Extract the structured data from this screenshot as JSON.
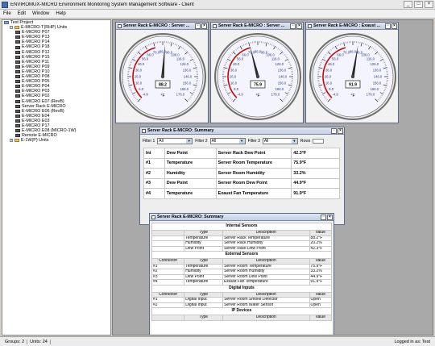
{
  "window": {
    "title": "ENVIROMUX-MICRO Environment Monitoring System Management Software - Client",
    "minimize": "_",
    "maximize": "□",
    "close": "×"
  },
  "menu": [
    "File",
    "Edit",
    "Window",
    "Help"
  ],
  "tree": {
    "root": "Test Project",
    "groups": [
      {
        "label": "E-MICRO-T(RHP) Units",
        "items": [
          "E-MICRO P07",
          "E-MICRO P13",
          "E-MICRO P14",
          "E-MICRO P18",
          "E-MICRO P12",
          "E-MICRO P15",
          "E-MICRO P11",
          "E-MICRO P09",
          "E-MICRO P10",
          "E-MICRO P08",
          "E-MICRO P05",
          "E-MICRO P04",
          "E-MICRO P03",
          "E-MICRO P02",
          "E-MICRO E07 (RevB)",
          "Server Rack E-MICRO",
          "E-MICRO E06 (RevB)",
          "E-MICRO E04",
          "E-MICRO E03",
          "E-MICRO P17",
          "E-MICRO E08 (MICRO-1W)",
          "Remote E-MICRO"
        ]
      },
      {
        "label": "E-1W(P) Units",
        "items": []
      }
    ]
  },
  "gauges": [
    {
      "title": "Server Rack E-MICRO : Server ...",
      "value": 88.2,
      "display": "88.2",
      "unit": "°F",
      "ticks": [
        "-4.9",
        "6.0",
        "16.0",
        "26.0",
        "36.0",
        "46.0",
        "56.0",
        "66.0",
        "76.0",
        "86.0",
        "96.0",
        "106.0",
        "116.0",
        "126.0",
        "136.0",
        "146.0",
        "156.0",
        "166.0",
        "176.0"
      ]
    },
    {
      "title": "Server Rack E-MICRO : Server ...",
      "value": 75.9,
      "display": "75.9",
      "unit": "°F",
      "ticks": [
        "-4.9",
        "6.0",
        "16.0",
        "26.0",
        "36.0",
        "46.0",
        "56.0",
        "66.0",
        "76.0",
        "86.0",
        "96.0",
        "106.0",
        "116.0",
        "126.0",
        "136.0",
        "146.0",
        "156.0",
        "166.0",
        "176.0"
      ]
    },
    {
      "title": "Server Rack E-MICRO : Exaust ...",
      "value": 91.9,
      "display": "91.9",
      "unit": "°F",
      "ticks": [
        "-4.9",
        "6.0",
        "16.0",
        "26.0",
        "36.0",
        "46.0",
        "56.0",
        "66.0",
        "76.0",
        "86.0",
        "96.0",
        "106.0",
        "116.0",
        "126.0",
        "136.0",
        "146.0",
        "156.0",
        "166.0",
        "176.0"
      ]
    }
  ],
  "summary": {
    "title": "Server Rack E-MICRO: Summary",
    "filter1_label": "Filter 1",
    "filter1_value": "All",
    "filter2_label": "Filter 2",
    "filter2_value": "All",
    "filter3_label": "Filter 3",
    "filter3_value": "All",
    "rows_label": "Rows",
    "rows": [
      [
        "Int",
        "Dew Point",
        "Server Rack Dew Point",
        "42.3°F"
      ],
      [
        "#1",
        "Temperature",
        "Server Room Temperature",
        "75.9°F"
      ],
      [
        "#2",
        "Humidity",
        "Server Room Humidity",
        "33.2%"
      ],
      [
        "#3",
        "Dew Point",
        "Server Room Dew Point",
        "44.9°F"
      ],
      [
        "#4",
        "Temperature",
        "Exaust Fan Temperature",
        "91.9°F"
      ]
    ]
  },
  "summary2": {
    "title": "Server Rack E-MICRO: Summary",
    "internal_title": "Internal Sensors",
    "internal_headers": [
      "Type",
      "Description",
      "Value"
    ],
    "internal_rows": [
      [
        "Temperature",
        "Server Rack Temperature",
        "88.2°F"
      ],
      [
        "Humidity",
        "Server Rack Humidity",
        "20.2%"
      ],
      [
        "Dew Point",
        "Server Rack Dew Point",
        "42.3°F"
      ]
    ],
    "external_title": "External Sensors",
    "external_headers": [
      "Connector",
      "Type",
      "Description",
      "Value"
    ],
    "external_rows": [
      [
        "#1",
        "Temperature",
        "Server Room Temperature",
        "75.9°F"
      ],
      [
        "#2",
        "Humidity",
        "Server Room Humidity",
        "33.2%"
      ],
      [
        "#3",
        "Dew Point",
        "Server Room Dew Point",
        "44.9°F"
      ],
      [
        "#4",
        "Temperature",
        "Exaust Fan Temperature",
        "91.9°F"
      ]
    ],
    "digital_title": "Digital Inputs",
    "digital_headers": [
      "Connector",
      "Type",
      "Description",
      "Value"
    ],
    "digital_rows": [
      [
        "#1",
        "Digital Input",
        "Server Room Smoke Detector",
        "Open"
      ],
      [
        "#2",
        "Digital Input",
        "Server Room Water Sensor",
        "Open"
      ]
    ],
    "ip_title": "IP Devices",
    "ip_headers": [
      "Type",
      "Description",
      "Value"
    ]
  },
  "status": {
    "groups": "Groups: 2",
    "units": "Units: 24",
    "login": "Logged in as: Test"
  }
}
